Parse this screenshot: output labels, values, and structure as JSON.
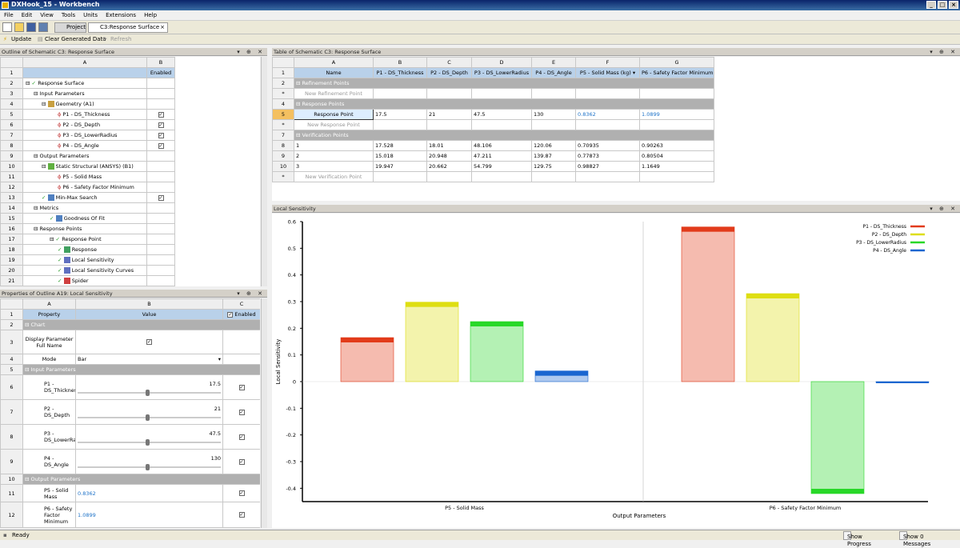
{
  "window": {
    "title": "DXHook_15 - Workbench"
  },
  "menu": [
    "File",
    "Edit",
    "View",
    "Tools",
    "Units",
    "Extensions",
    "Help"
  ],
  "tabs": {
    "project": "Project",
    "response": "C3:Response Surface"
  },
  "toolbar2": {
    "update": "Update",
    "clear": "Clear Generated Data",
    "refresh": "Refresh"
  },
  "outline": {
    "title": "Outline of Schematic C3: Response Surface",
    "colA": "A",
    "colB": "B",
    "enabled": "Enabled",
    "rows": [
      {
        "n": "1",
        "label": "",
        "indent": 0,
        "chk": false
      },
      {
        "n": "2",
        "label": "Response Surface",
        "indent": 0,
        "chk": false
      },
      {
        "n": "3",
        "label": "Input Parameters",
        "indent": 1,
        "chk": false
      },
      {
        "n": "4",
        "label": "Geometry (A1)",
        "indent": 2,
        "chk": false
      },
      {
        "n": "5",
        "label": "P1 - DS_Thickness",
        "indent": 4,
        "chk": true
      },
      {
        "n": "6",
        "label": "P2 - DS_Depth",
        "indent": 4,
        "chk": true
      },
      {
        "n": "7",
        "label": "P3 - DS_LowerRadius",
        "indent": 4,
        "chk": true
      },
      {
        "n": "8",
        "label": "P4 - DS_Angle",
        "indent": 4,
        "chk": true
      },
      {
        "n": "9",
        "label": "Output Parameters",
        "indent": 1,
        "chk": false
      },
      {
        "n": "10",
        "label": "Static Structural (ANSYS) (B1)",
        "indent": 2,
        "chk": false
      },
      {
        "n": "11",
        "label": "P5 - Solid Mass",
        "indent": 4,
        "chk": false
      },
      {
        "n": "12",
        "label": "P6 - Safety Factor Minimum",
        "indent": 4,
        "chk": false
      },
      {
        "n": "13",
        "label": "Min-Max Search",
        "indent": 2,
        "chk": true
      },
      {
        "n": "14",
        "label": "Metrics",
        "indent": 1,
        "chk": false
      },
      {
        "n": "15",
        "label": "Goodness Of Fit",
        "indent": 3,
        "chk": false
      },
      {
        "n": "16",
        "label": "Response Points",
        "indent": 1,
        "chk": false
      },
      {
        "n": "17",
        "label": "Response Point",
        "indent": 3,
        "chk": false
      },
      {
        "n": "18",
        "label": "Response",
        "indent": 4,
        "chk": false
      },
      {
        "n": "19",
        "label": "Local Sensitivity",
        "indent": 4,
        "chk": false
      },
      {
        "n": "20",
        "label": "Local Sensitivity Curves",
        "indent": 4,
        "chk": false
      },
      {
        "n": "21",
        "label": "Spider",
        "indent": 4,
        "chk": false
      }
    ]
  },
  "props": {
    "title": "Properties of Outline A19: Local Sensitivity",
    "colA": "A",
    "colB": "B",
    "colC": "C",
    "property": "Property",
    "value": "Value",
    "enabled": "Enabled",
    "chart_section": "Chart",
    "display_param": "Display Parameter Full Name",
    "mode_label": "Mode",
    "mode_value": "Bar",
    "input_section": "Input Parameters",
    "p1": "P1 - DS_Thickness",
    "p1v": "17.5",
    "p2": "P2 - DS_Depth",
    "p2v": "21",
    "p3": "P3 - DS_LowerRadius",
    "p3v": "47.5",
    "p4": "P4 - DS_Angle",
    "p4v": "130",
    "output_section": "Output Parameters",
    "p5": "P5 - Solid Mass",
    "p5v": "0.8362",
    "p6": "P6 - Safety Factor Minimum",
    "p6v": "1.0899",
    "rownums": [
      "1",
      "2",
      "3",
      "4",
      "5",
      "6",
      "7",
      "8",
      "9",
      "10",
      "11",
      "12"
    ]
  },
  "table": {
    "title": "Table of Schematic C3: Response Surface",
    "cols": [
      "A",
      "B",
      "C",
      "D",
      "E",
      "F",
      "G"
    ],
    "headers": [
      "Name",
      "P1 - DS_Thickness",
      "P2 - DS_Depth",
      "P3 - DS_LowerRadius",
      "P4 - DS_Angle",
      "P5 - Solid Mass (kg)",
      "P6 - Safety Factor Minimum"
    ],
    "refinement": "Refinement Points",
    "new_refinement": "New Refinement Point",
    "response_points": "Response Points",
    "response_row": [
      "Response Point",
      "17.5",
      "21",
      "47.5",
      "130",
      "0.8362",
      "1.0899"
    ],
    "new_response": "New Response Point",
    "verification": "Verification Points",
    "ver_rows": [
      [
        "1",
        "17.528",
        "18.01",
        "48.106",
        "120.06",
        "0.70935",
        "0.90263"
      ],
      [
        "2",
        "15.018",
        "20.948",
        "47.211",
        "139.87",
        "0.77873",
        "0.80504"
      ],
      [
        "3",
        "19.947",
        "20.662",
        "54.799",
        "129.75",
        "0.98827",
        "1.1649"
      ]
    ],
    "new_verification": "New Verification Point",
    "rownums": [
      "1",
      "2",
      "*",
      "4",
      "5",
      "*",
      "7",
      "8",
      "9",
      "10",
      "*"
    ]
  },
  "chart_panel": {
    "title": "Local Sensitivity"
  },
  "chart_data": {
    "type": "bar",
    "categories": [
      "P5 - Solid Mass",
      "P6 - Safety Factor Minimum"
    ],
    "series": [
      {
        "name": "P1 - DS_Thickness",
        "color": "#e23b1a",
        "values": [
          0.165,
          0.58
        ]
      },
      {
        "name": "P2 - DS_Depth",
        "color": "#dede12",
        "values": [
          0.298,
          0.33
        ]
      },
      {
        "name": "P3 - DS_LowerRadius",
        "color": "#28d828",
        "values": [
          0.225,
          -0.42
        ]
      },
      {
        "name": "P4 - DS_Angle",
        "color": "#1a66d0",
        "values": [
          0.04,
          0.0
        ]
      }
    ],
    "ylabel": "Local Sensitivity",
    "xlabel": "Output Parameters",
    "ylim": [
      -0.45,
      0.6
    ],
    "yticks": [
      "0.6",
      "0.5",
      "0.4",
      "0.3",
      "0.2",
      "0.1",
      "0",
      "-0.1",
      "-0.2",
      "-0.3",
      "-0.4"
    ],
    "legend": "top-right"
  },
  "status": {
    "ready": "Ready",
    "progress": "Show Progress",
    "messages": "Show 0 Messages"
  }
}
